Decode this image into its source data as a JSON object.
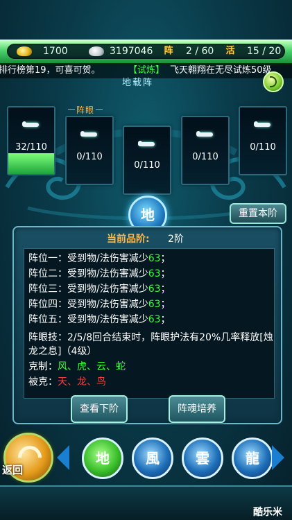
{
  "resources": {
    "gold_value": "1700",
    "silver_value": "3197046",
    "formation_tag": "阵",
    "formation_count": "2 / 60",
    "activity_tag": "活",
    "activity_count": "15 / 20"
  },
  "marquee": {
    "text_left": "排行榜第19，可喜可贺。",
    "text_tag": "【试炼】",
    "text_right": "飞天翱翔在无尽试炼50级"
  },
  "formation": {
    "section_title": "地载阵",
    "eye_label": "阵眼",
    "slots": [
      {
        "value": "32/110",
        "fill_fraction": 0.29
      },
      {
        "value": "0/110"
      },
      {
        "value": "0/110"
      },
      {
        "value": "0/110"
      },
      {
        "value": "0/110"
      }
    ],
    "emblem": "地",
    "reset_button": "重置本阶"
  },
  "panel": {
    "grade_label": "当前品阶:",
    "grade_value": "2阶",
    "rows": [
      {
        "label": "阵位一：受到物/法伤害减少",
        "num": "63",
        "end": "；"
      },
      {
        "label": "阵位二：受到物/法伤害减少",
        "num": "63",
        "end": "；"
      },
      {
        "label": "阵位三：受到物/法伤害减少",
        "num": "63",
        "end": "；"
      },
      {
        "label": "阵位四：受到物/法伤害减少",
        "num": "63",
        "end": "；"
      },
      {
        "label": "阵位五：受到物/法伤害减少",
        "num": "63",
        "end": "；"
      }
    ],
    "skill_line1": "阵眼技：2/5/8回合结束时，阵眼护法有20%几率释放[烛",
    "skill_line2": "龙之息]（4级）",
    "counter_label": "克制：",
    "counter_value": "风、虎、云、蛇",
    "countered_label": "被克：",
    "countered_value": "天、龙、鸟"
  },
  "buttons": {
    "next_grade": "查看下阶",
    "soul_train": "阵魂培养"
  },
  "nav": {
    "back_label": "返回",
    "elements": [
      "地",
      "風",
      "雲",
      "龍"
    ]
  },
  "watermark": "酷乐米",
  "colors": {
    "accent_green": "#3cff3c",
    "accent_red": "#ff3b3b",
    "tag_gold": "#ffd23a",
    "eye_orange": "#ffb84a"
  }
}
